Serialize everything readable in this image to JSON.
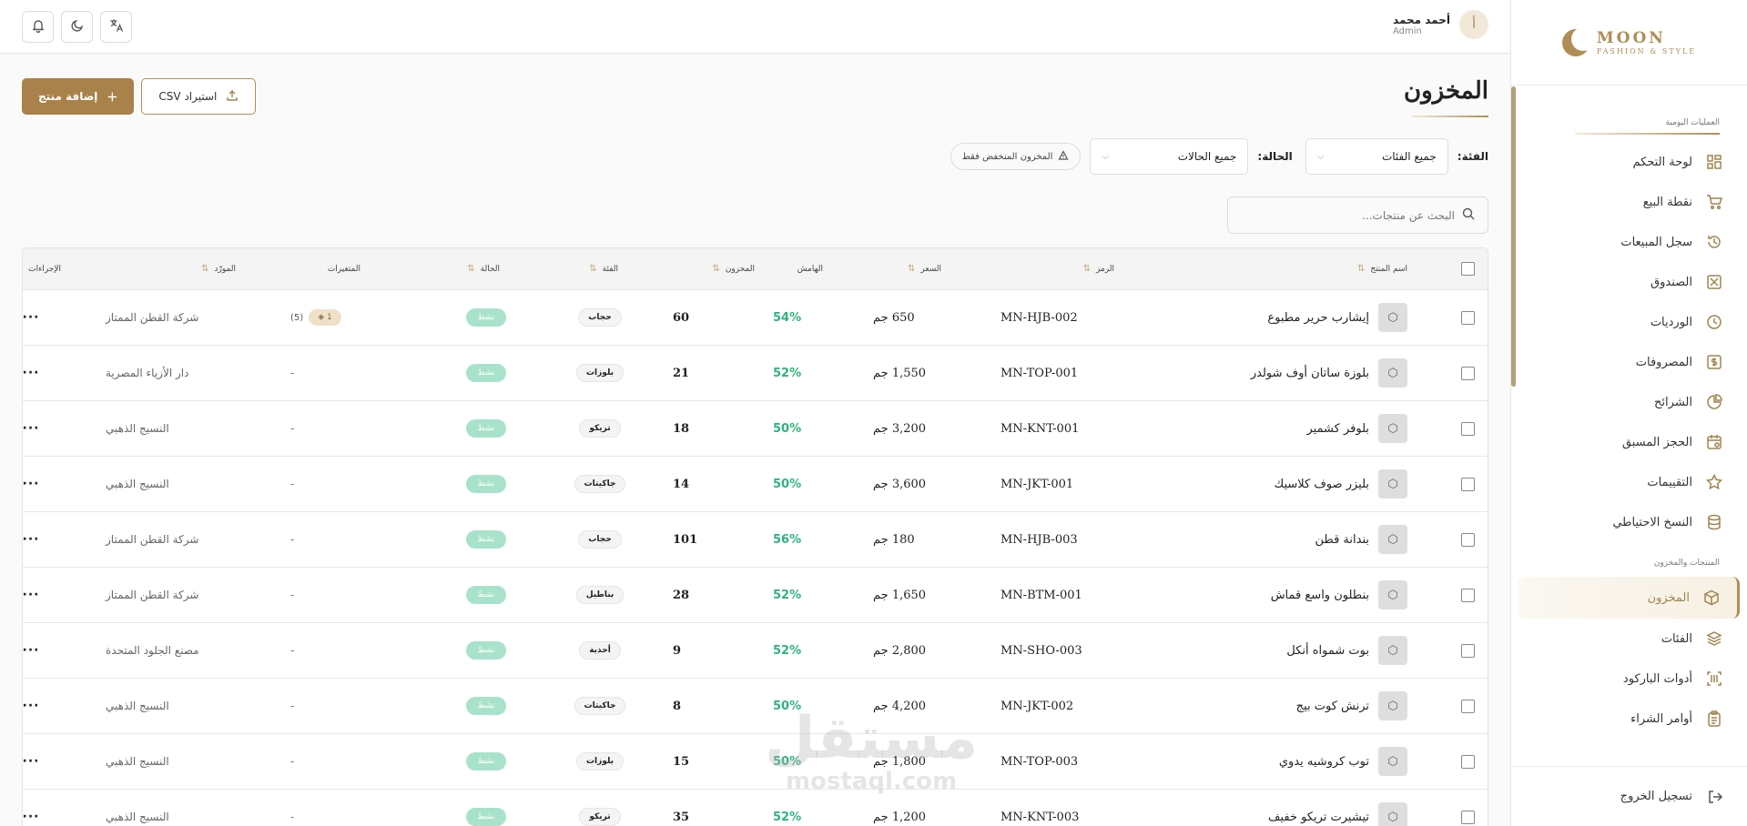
{
  "brand": {
    "name": "MOON",
    "tagline": "FASHION & STYLE"
  },
  "header": {
    "user_initial": "أ",
    "user_name": "أحمد محمد",
    "user_role": "Admin"
  },
  "sidebar": {
    "section_daily": "العمليات اليومية",
    "section_products": "المنتجات والمخزون",
    "daily_items": [
      {
        "label": "لوحة التحكم",
        "icon": "dashboard-icon"
      },
      {
        "label": "نقطة البيع",
        "icon": "cart-icon"
      },
      {
        "label": "سجل المبيعات",
        "icon": "history-icon"
      },
      {
        "label": "الصندوق",
        "icon": "cash-box-icon"
      },
      {
        "label": "الورديات",
        "icon": "clock-icon"
      },
      {
        "label": "المصروفات",
        "icon": "dollar-icon"
      },
      {
        "label": "الشرائح",
        "icon": "pie-chart-icon"
      },
      {
        "label": "الحجز المسبق",
        "icon": "calendar-icon"
      },
      {
        "label": "التقييمات",
        "icon": "star-icon"
      },
      {
        "label": "النسخ الاحتياطي",
        "icon": "database-icon"
      }
    ],
    "product_items": [
      {
        "label": "المخزون",
        "icon": "box-icon",
        "active": true
      },
      {
        "label": "الفئات",
        "icon": "layers-icon"
      },
      {
        "label": "أدوات الباركود",
        "icon": "barcode-icon"
      },
      {
        "label": "أوامر الشراء",
        "icon": "clipboard-icon"
      }
    ],
    "logout": "تسجيل الخروج"
  },
  "page": {
    "title": "المخزون",
    "add_button": "إضافة منتج",
    "import_button": "استيراد CSV",
    "category_label": "الفئة:",
    "category_value": "جميع الفئات",
    "status_label": "الحالة:",
    "status_value": "جميع الحالات",
    "low_stock_chip": "المخزون المنخفض فقط",
    "search_placeholder": "البحث عن منتجات..."
  },
  "table": {
    "headers": {
      "name": "اسم المنتج",
      "sku": "الرمز",
      "price": "السعر",
      "margin": "الهامش",
      "stock": "المخزون",
      "category": "الفئة",
      "status": "الحالة",
      "variants": "المتغيرات",
      "supplier": "المورّد",
      "actions": "الإجراءات"
    },
    "rows": [
      {
        "name": "إيشارب حرير مطبوع",
        "sku": "MN-HJB-002",
        "price": "650 جم",
        "margin": "54%",
        "stock": "60",
        "category": "حجاب",
        "status": "نشط",
        "variants_badge": "1",
        "variants_count": "(5)",
        "supplier": "شركة القطن الممتاز",
        "actions": "···"
      },
      {
        "name": "بلوزة ساتان أوف شولدر",
        "sku": "MN-TOP-001",
        "price": "1,550 جم",
        "margin": "52%",
        "stock": "21",
        "category": "بلوزات",
        "status": "نشط",
        "variants": "-",
        "supplier": "دار الأزياء المصرية",
        "actions": "···"
      },
      {
        "name": "بلوفر كشمير",
        "sku": "MN-KNT-001",
        "price": "3,200 جم",
        "margin": "50%",
        "stock": "18",
        "category": "تريكو",
        "status": "نشط",
        "variants": "-",
        "supplier": "النسيج الذهبي",
        "actions": "···"
      },
      {
        "name": "بليزر صوف كلاسيك",
        "sku": "MN-JKT-001",
        "price": "3,600 جم",
        "margin": "50%",
        "stock": "14",
        "category": "جاكيتات",
        "status": "نشط",
        "variants": "-",
        "supplier": "النسيج الذهبي",
        "actions": "···"
      },
      {
        "name": "بندانة قطن",
        "sku": "MN-HJB-003",
        "price": "180 جم",
        "margin": "56%",
        "stock": "101",
        "category": "حجاب",
        "status": "نشط",
        "variants": "-",
        "supplier": "شركة القطن الممتاز",
        "actions": "···"
      },
      {
        "name": "بنطلون واسع قماش",
        "sku": "MN-BTM-001",
        "price": "1,650 جم",
        "margin": "52%",
        "stock": "28",
        "category": "بناطيل",
        "status": "نشط",
        "variants": "-",
        "supplier": "شركة القطن الممتاز",
        "actions": "···"
      },
      {
        "name": "بوت شمواه أنكل",
        "sku": "MN-SHO-003",
        "price": "2,800 جم",
        "margin": "52%",
        "stock": "9",
        "category": "أحذية",
        "status": "نشط",
        "variants": "-",
        "supplier": "مصنع الجلود المتحدة",
        "actions": "···"
      },
      {
        "name": "ترنش كوت بيج",
        "sku": "MN-JKT-002",
        "price": "4,200 جم",
        "margin": "50%",
        "stock": "8",
        "category": "جاكيتات",
        "status": "نشط",
        "variants": "-",
        "supplier": "النسيج الذهبي",
        "actions": "···"
      },
      {
        "name": "توب كروشيه يدوي",
        "sku": "MN-TOP-003",
        "price": "1,800 جم",
        "margin": "50%",
        "stock": "15",
        "category": "بلوزات",
        "status": "نشط",
        "variants": "-",
        "supplier": "النسيج الذهبي",
        "actions": "···"
      },
      {
        "name": "تيشيرت تريكو خفيف",
        "sku": "MN-KNT-003",
        "price": "1,200 جم",
        "margin": "52%",
        "stock": "35",
        "category": "تريكو",
        "status": "نشط",
        "variants": "-",
        "supplier": "النسيج الذهبي",
        "actions": "···"
      }
    ]
  },
  "watermark": {
    "arabic": "مستقل",
    "latin": "mostaql.com"
  },
  "colors": {
    "accent": "#b08d55",
    "margin": "#2fb37d",
    "status": "#a9e2cb"
  }
}
